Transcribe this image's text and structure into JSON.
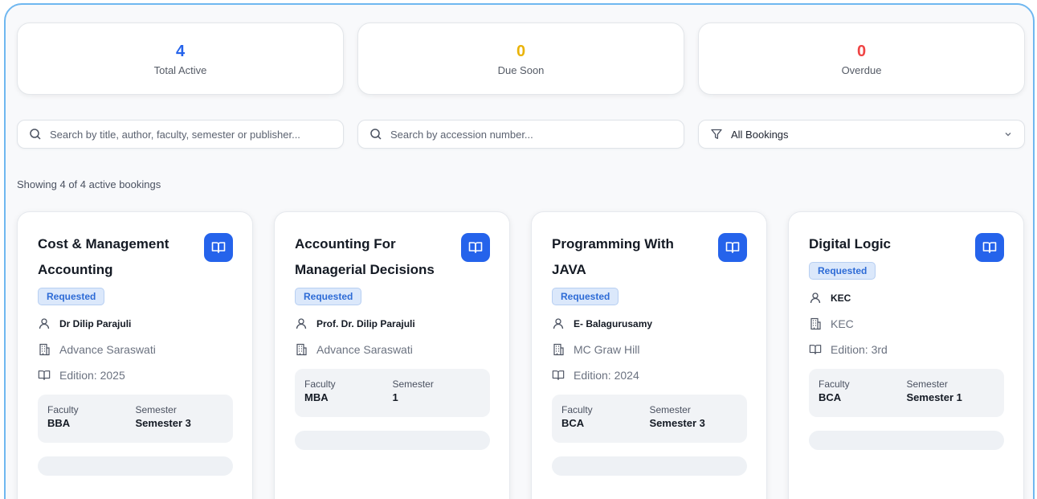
{
  "stats": [
    {
      "value": "4",
      "label": "Total Active",
      "color": "#2563eb"
    },
    {
      "value": "0",
      "label": "Due Soon",
      "color": "#eab308"
    },
    {
      "value": "0",
      "label": "Overdue",
      "color": "#ef4444"
    }
  ],
  "search": {
    "main_placeholder": "Search by title, author, faculty, semester or publisher...",
    "accession_placeholder": "Search by accession number...",
    "filter_value": "All Bookings"
  },
  "showing_text": "Showing 4 of 4 active bookings",
  "labels": {
    "faculty": "Faculty",
    "semester": "Semester"
  },
  "books": [
    {
      "title": "Cost & Management Accounting",
      "status": "Requested",
      "author": "Dr Dilip Parajuli",
      "publisher": "Advance Saraswati",
      "edition": "Edition: 2025",
      "faculty": "BBA",
      "semester": "Semester 3"
    },
    {
      "title": "Accounting For Managerial Decisions",
      "status": "Requested",
      "author": "Prof. Dr. Dilip Parajuli",
      "publisher": "Advance Saraswati",
      "edition": "",
      "faculty": "MBA",
      "semester": "1"
    },
    {
      "title": "Programming With JAVA",
      "status": "Requested",
      "author": "E- Balagurusamy",
      "publisher": "MC Graw Hill",
      "edition": "Edition: 2024",
      "faculty": "BCA",
      "semester": "Semester 3"
    },
    {
      "title": "Digital Logic",
      "status": "Requested",
      "author": "KEC",
      "publisher": "KEC",
      "edition": "Edition: 3rd",
      "faculty": "BCA",
      "semester": "Semester 1"
    }
  ]
}
